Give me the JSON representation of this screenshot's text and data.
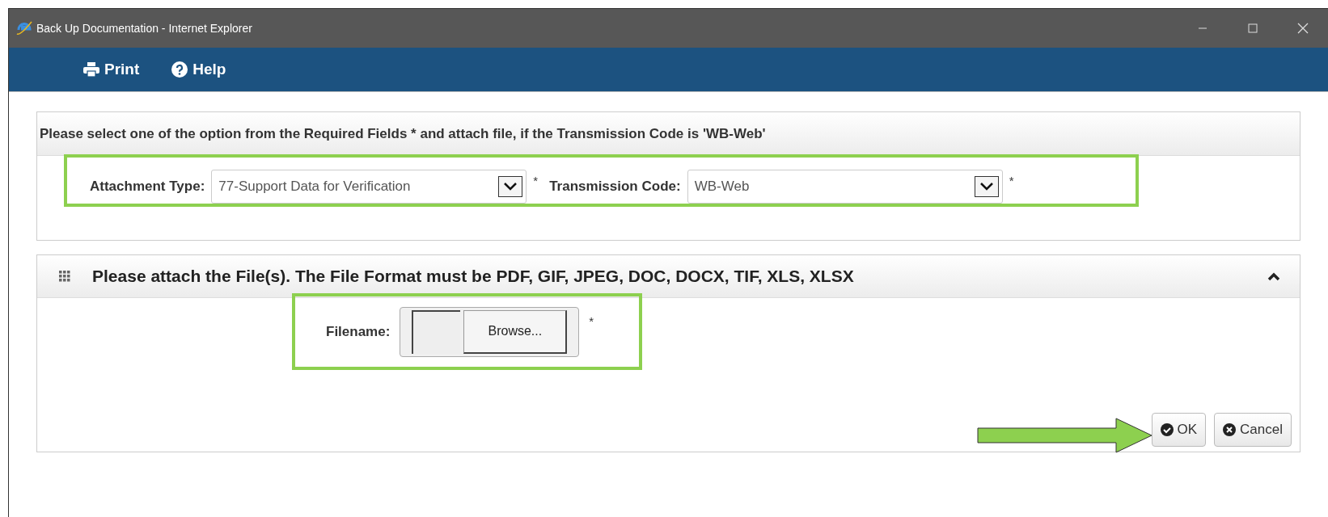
{
  "window": {
    "title": "Back Up Documentation - Internet Explorer"
  },
  "toolbar": [
    {
      "kind": "print",
      "label": "Print"
    },
    {
      "kind": "help",
      "label": "Help"
    }
  ],
  "selection_panel": {
    "instruction": "Please select one of the option from the Required Fields * and attach file, if the Transmission Code is 'WB-Web'",
    "fields": [
      {
        "label": "Attachment Type:",
        "value": "77-Support Data for Verification",
        "required": "*"
      },
      {
        "label": "Transmission Code:",
        "value": "WB-Web",
        "required": "*"
      }
    ]
  },
  "attach_panel": {
    "title": "Please attach the File(s). The File Format must be PDF, GIF, JPEG, DOC, DOCX, TIF, XLS, XLSX",
    "expanded": true,
    "filename": {
      "label": "Filename:",
      "button": "Browse...",
      "required": "*"
    },
    "buttons": [
      {
        "kind": "ok",
        "label": "OK"
      },
      {
        "kind": "cancel",
        "label": "Cancel"
      }
    ]
  }
}
